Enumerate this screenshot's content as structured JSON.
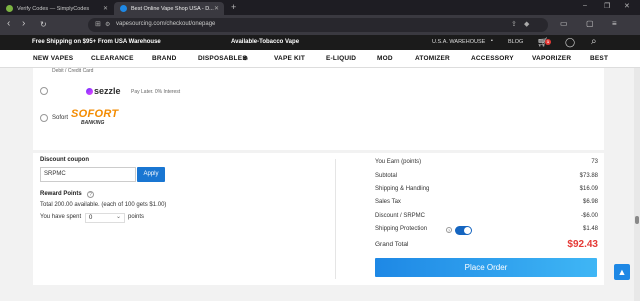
{
  "browser": {
    "tabs": [
      {
        "title": "Verify Codes — SimplyCodes",
        "favicon_color": "#7cb342"
      },
      {
        "title": "Best Online Vape Shop USA - D...",
        "favicon_color": "#1e88e5"
      }
    ],
    "new_tab": "+",
    "url": "vapesourcing.com/checkout/onepage",
    "window_controls": [
      "–",
      "❐",
      "✕"
    ]
  },
  "site": {
    "promo_left": "Free Shipping on $95+ From USA Warehouse",
    "promo_center": "Available-Tobacco Vape",
    "warehouse": "U.S.A. WAREHOUSE",
    "blog": "BLOG",
    "cart_count": "1",
    "nav": [
      "NEW VAPES",
      "CLEARANCE",
      "BRAND",
      "DISPOSABLES",
      "VAPE KIT",
      "E-LIQUID",
      "MOD",
      "ATOMIZER",
      "ACCESSORY",
      "VAPORIZER",
      "BEST"
    ]
  },
  "payment": {
    "debit_label": "Debit / Credit Card",
    "sezzle_name": "sezzle",
    "sezzle_note": "Pay Later. 0% Interest",
    "sofort_word": "Sofort",
    "sofort_logo_big": "SOFORT",
    "sofort_logo_small": "BANKING"
  },
  "discount": {
    "title": "Discount coupon",
    "code": "SRPMC",
    "apply": "Apply",
    "reward_title": "Reward Points",
    "reward_available": "Total 200.00 available. (each of 100 gets $1.00)",
    "spent_prefix": "You have spent",
    "spent_value": "0",
    "spent_suffix": "points"
  },
  "summary": {
    "rows": [
      {
        "label": "You Earn (points)",
        "value": "73"
      },
      {
        "label": "Subtotal",
        "value": "$73.88"
      },
      {
        "label": "Shipping & Handling",
        "value": "$16.09"
      },
      {
        "label": "Sales Tax",
        "value": "$6.98"
      },
      {
        "label": "Discount / SRPMC",
        "value": "-$6.00"
      },
      {
        "label": "Shipping Protection",
        "value": "$1.48"
      }
    ],
    "grand_total_label": "Grand Total",
    "grand_total_value": "$92.43",
    "place_order": "Place Order"
  },
  "colors": {
    "accent": "#1976d2",
    "total": "#e53935"
  }
}
